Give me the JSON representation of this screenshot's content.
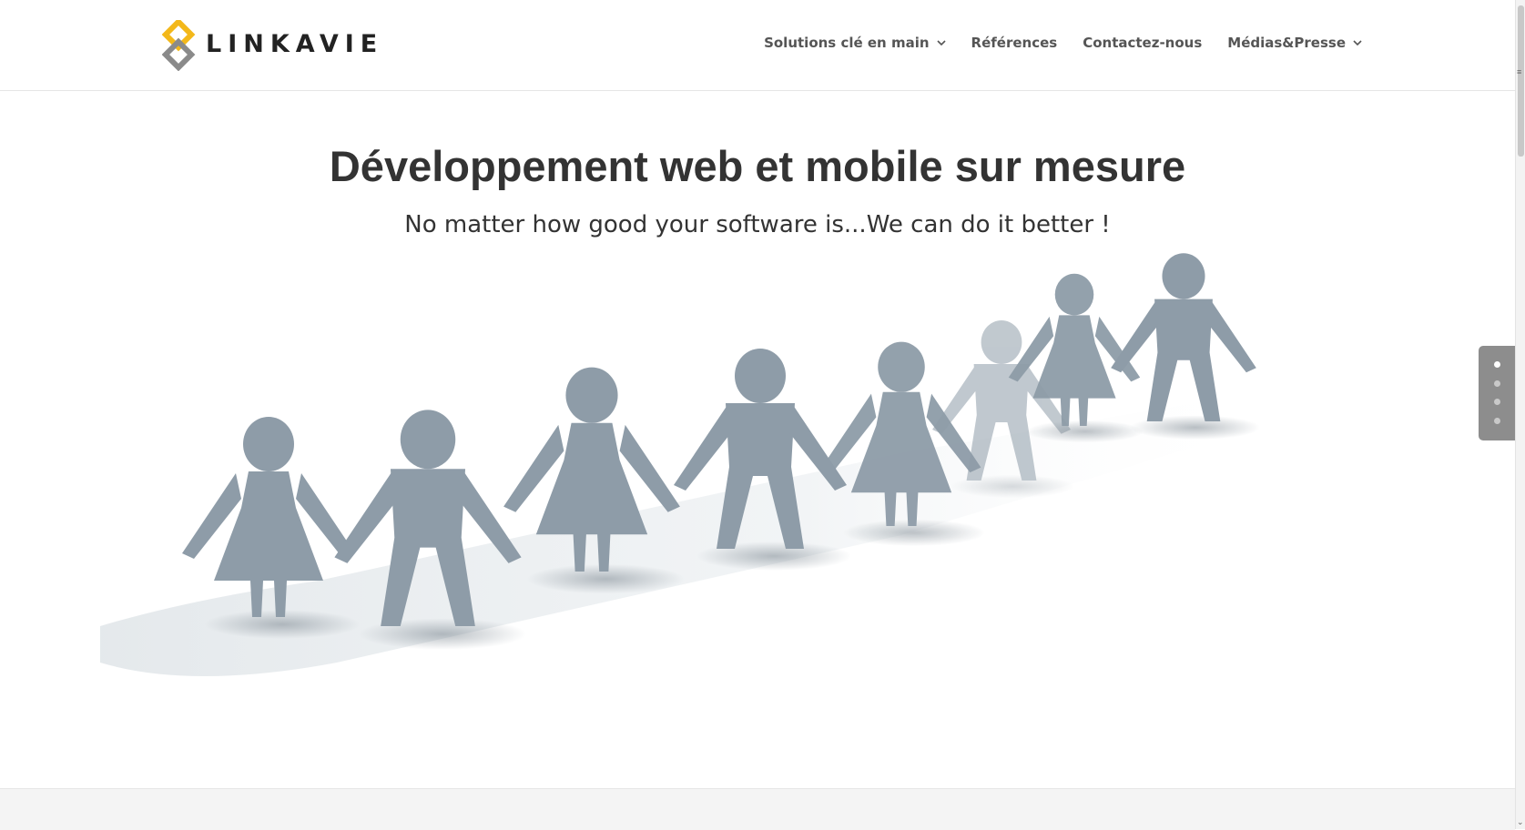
{
  "brand": {
    "logo_text": "LINKAVIE",
    "accent": "#f3b81a",
    "mark_gray": "#8a8a8a"
  },
  "nav": {
    "items": [
      {
        "label": "Solutions clé en main",
        "has_dropdown": true
      },
      {
        "label": "Références",
        "has_dropdown": false
      },
      {
        "label": "Contactez-nous",
        "has_dropdown": false
      },
      {
        "label": "Médias&Presse",
        "has_dropdown": true
      }
    ]
  },
  "hero": {
    "title": "Développement web et mobile sur mesure",
    "subtitle": "No matter how good your software is...We can do it better !",
    "figure_color": "#8e9ca8"
  },
  "slider": {
    "count": 4,
    "active_index": 1
  }
}
